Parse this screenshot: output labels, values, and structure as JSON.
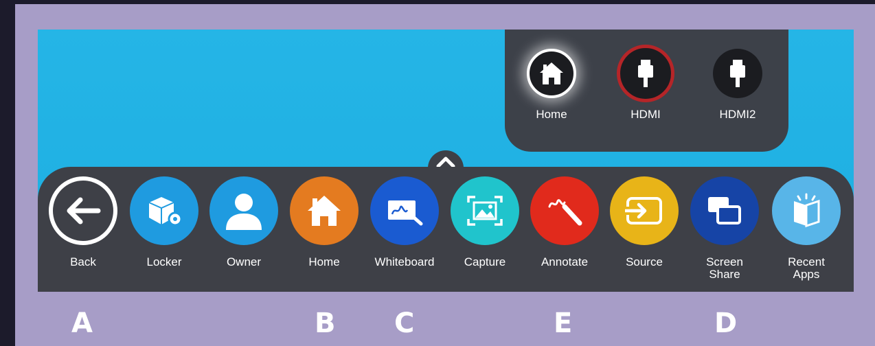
{
  "source_panel": {
    "sources": [
      {
        "label": "Home",
        "icon": "house-icon"
      },
      {
        "label": "HDMI",
        "icon": "hdmi-plug-icon"
      },
      {
        "label": "HDMI2",
        "icon": "hdmi-plug-icon"
      }
    ]
  },
  "dock": {
    "toggle_icon": "chevron-up-icon",
    "items": [
      {
        "label": "Back",
        "icon": "arrow-left-icon",
        "color": "#3e4047"
      },
      {
        "label": "Locker",
        "icon": "locker-box-icon",
        "color": "#1f9be0"
      },
      {
        "label": "Owner",
        "icon": "person-icon",
        "color": "#1f9be0"
      },
      {
        "label": "Home",
        "icon": "house-icon",
        "color": "#e47b20"
      },
      {
        "label": "Whiteboard",
        "icon": "whiteboard-icon",
        "color": "#1a5bd1"
      },
      {
        "label": "Capture",
        "icon": "capture-icon",
        "color": "#20c4cc"
      },
      {
        "label": "Annotate",
        "icon": "pen-icon",
        "color": "#e12a1c"
      },
      {
        "label": "Source",
        "icon": "input-source-icon",
        "color": "#e8b418"
      },
      {
        "label": "Screen\nShare",
        "line1": "Screen",
        "line2": "Share",
        "icon": "screen-share-icon",
        "color": "#1644a6"
      },
      {
        "label": "Recent\nApps",
        "line1": "Recent",
        "line2": "Apps",
        "icon": "book-icon",
        "color": "#58b5e8"
      }
    ]
  },
  "callouts": [
    "A",
    "B",
    "C",
    "E",
    "D"
  ]
}
